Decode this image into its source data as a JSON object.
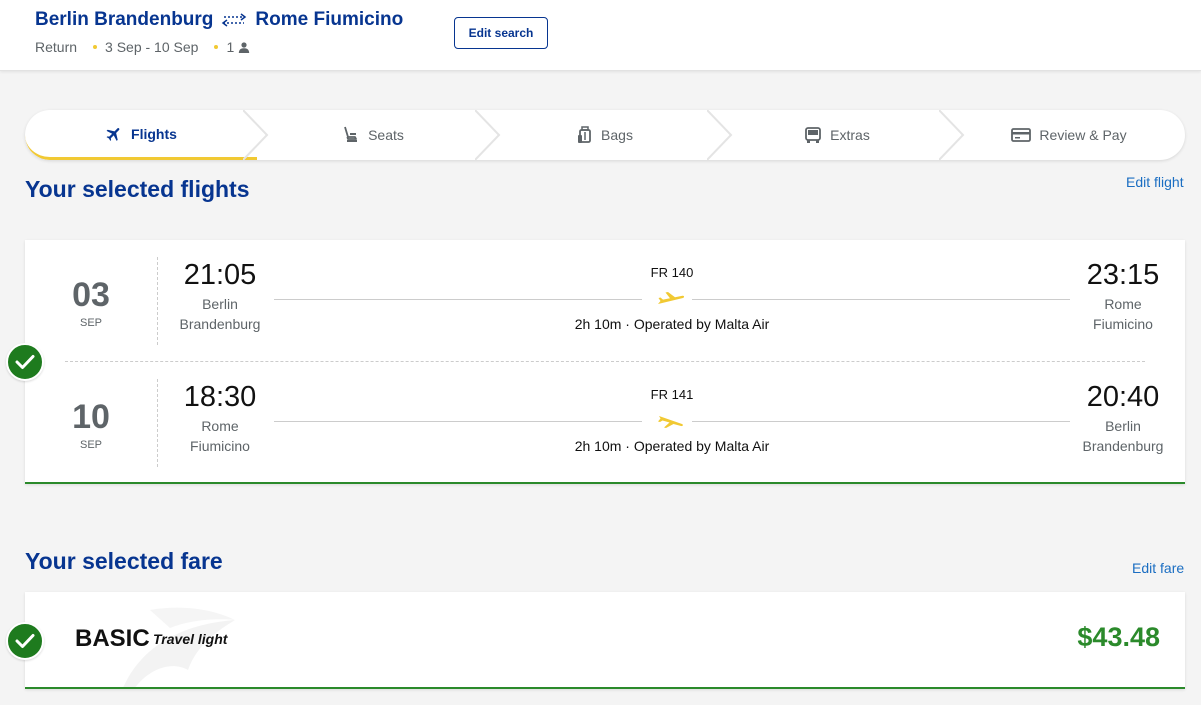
{
  "header": {
    "origin": "Berlin Brandenburg",
    "destination": "Rome Fiumicino",
    "trip_type": "Return",
    "dates": "3 Sep - 10 Sep",
    "passengers": "1",
    "edit_search_label": "Edit search"
  },
  "stepper": {
    "steps": [
      {
        "label": "Flights",
        "icon": "plane-icon",
        "active": true
      },
      {
        "label": "Seats",
        "icon": "seat-icon",
        "active": false
      },
      {
        "label": "Bags",
        "icon": "bag-icon",
        "active": false
      },
      {
        "label": "Extras",
        "icon": "bus-icon",
        "active": false
      },
      {
        "label": "Review & Pay",
        "icon": "card-icon",
        "active": false
      }
    ]
  },
  "flights_section": {
    "title": "Your selected flights",
    "edit_label": "Edit flight",
    "flights": [
      {
        "day": "03",
        "month": "SEP",
        "dep_time": "21:05",
        "dep_city_1": "Berlin",
        "dep_city_2": "Brandenburg",
        "arr_time": "23:15",
        "arr_city_1": "Rome",
        "arr_city_2": "Fiumicino",
        "flight_number": "FR 140",
        "info": "2h 10m · Operated by Malta Air"
      },
      {
        "day": "10",
        "month": "SEP",
        "dep_time": "18:30",
        "dep_city_1": "Rome",
        "dep_city_2": "Fiumicino",
        "arr_time": "20:40",
        "arr_city_1": "Berlin",
        "arr_city_2": "Brandenburg",
        "flight_number": "FR 141",
        "info": "2h 10m · Operated by Malta Air"
      }
    ]
  },
  "fare_section": {
    "title": "Your selected fare",
    "edit_label": "Edit fare",
    "fare_name": "BASIC",
    "fare_tagline": "Travel light",
    "price": "$43.48"
  },
  "colors": {
    "brand_blue": "#073590",
    "accent_yellow": "#f1c933",
    "success_green": "#2b8a2b",
    "background": "#f4f4f4"
  }
}
